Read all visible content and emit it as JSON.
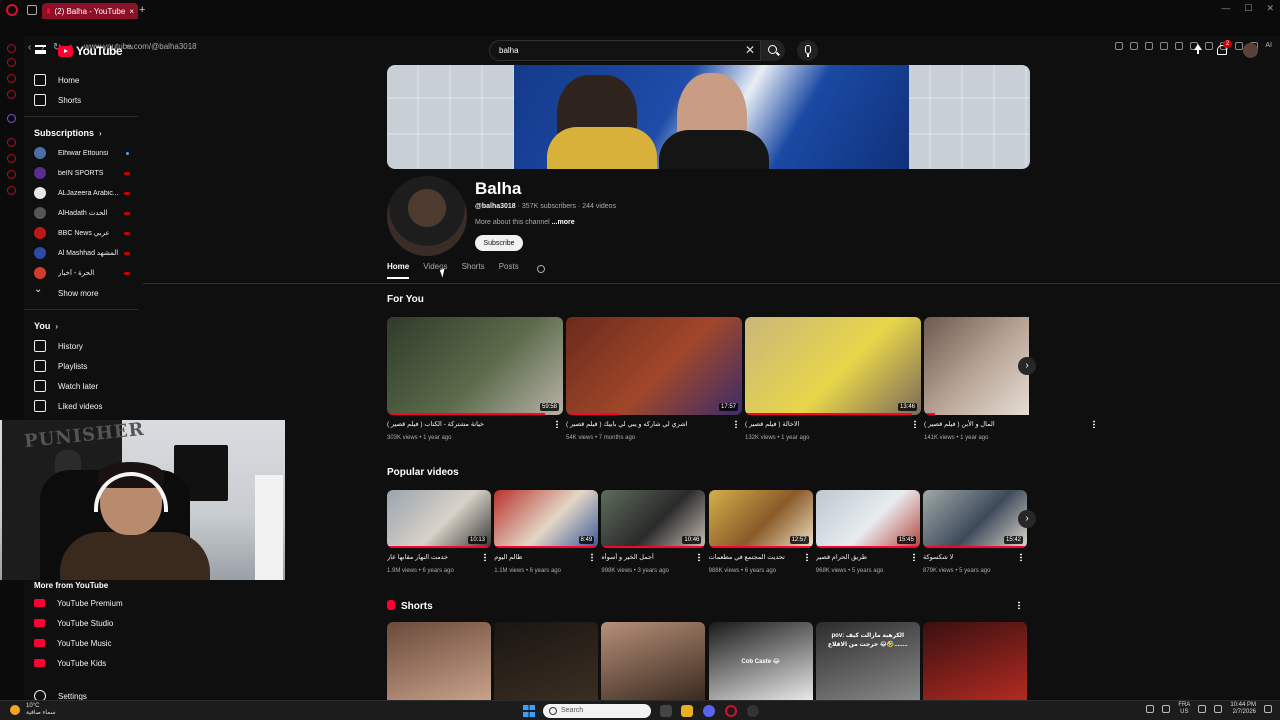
{
  "browser": {
    "tab_title": "(2) Balha - YouTube",
    "url": "www.youtube.com/@balha3018",
    "ai_label": "AI"
  },
  "header": {
    "logo_text": "YouTube",
    "logo_tm": "TN",
    "search_value": "balha",
    "notification_count": "2"
  },
  "sidebar": {
    "main": [
      {
        "label": "Home",
        "icon": "home-icon"
      },
      {
        "label": "Shorts",
        "icon": "shorts-icon"
      }
    ],
    "subscriptions_title": "Subscriptions",
    "subscriptions": [
      {
        "label": "Elhiwar Ettounsi",
        "color": "#4a6fa5",
        "indicator": "dot"
      },
      {
        "label": "beIN SPORTS",
        "color": "#5b2d8e",
        "indicator": "live"
      },
      {
        "label": "ALJazeera Arabic...",
        "color": "#e8e8e8",
        "indicator": "live"
      },
      {
        "label": "AlHadath الحدث",
        "color": "#555555",
        "indicator": "live"
      },
      {
        "label": "BBC News عربي",
        "color": "#bb1919",
        "indicator": "live"
      },
      {
        "label": "Al Mashhad المشهد",
        "color": "#2c4aa8",
        "indicator": "live"
      },
      {
        "label": "الحرة - أخبار",
        "color": "#d23a2a",
        "indicator": "live"
      }
    ],
    "show_more": "Show more",
    "you_title": "You",
    "you_items": [
      {
        "label": "History",
        "icon": "history-icon"
      },
      {
        "label": "Playlists",
        "icon": "playlists-icon"
      },
      {
        "label": "Watch later",
        "icon": "watch-later-icon"
      },
      {
        "label": "Liked videos",
        "icon": "like-icon"
      }
    ],
    "more_title": "More from YouTube",
    "more_items": [
      {
        "label": "YouTube Premium"
      },
      {
        "label": "YouTube Studio"
      },
      {
        "label": "YouTube Music"
      },
      {
        "label": "YouTube Kids"
      }
    ],
    "settings": "Settings"
  },
  "webcam": {
    "poster_text": "PUNISHER"
  },
  "channel": {
    "name": "Balha",
    "handle": "@balha3018",
    "stats": " · 357K subscribers · 244 videos",
    "about": "More about this channel",
    "about_more": "...more",
    "subscribe": "Subscribe",
    "tabs": [
      "Home",
      "Videos",
      "Shorts",
      "Posts"
    ]
  },
  "for_you": {
    "title": "For You",
    "videos": [
      {
        "title": "خيانة مشتركة - الكتاب ( فيلم قصير )",
        "meta": "303K views • 1 year ago",
        "duration": "59:58",
        "progress": 0.9,
        "colors": [
          "#2f3b2a",
          "#5b6b4a",
          "#b8b2a8"
        ]
      },
      {
        "title": "اشري لي شاركه و يبي لي بابيك ( فيلم قصير )",
        "meta": "54K views • 7 months ago",
        "duration": "17:57",
        "progress": 0.3,
        "colors": [
          "#6b2a1c",
          "#a0472a",
          "#3c2c6a"
        ]
      },
      {
        "title": "الاخالة ( فيلم قصير )",
        "meta": "132K views • 1 year ago",
        "duration": "13:46",
        "progress": 0.95,
        "colors": [
          "#c9b77a",
          "#e8d64a",
          "#7a6a5a"
        ]
      },
      {
        "title": "المال و الأبن ( فيلم قصير )",
        "meta": "141K views • 1 year ago",
        "duration": "",
        "progress": 0.1,
        "colors": [
          "#6e5a4e",
          "#bba89a",
          "#e6ddd4"
        ]
      }
    ]
  },
  "popular": {
    "title": "Popular videos",
    "videos": [
      {
        "title": "خدمت النهار مقابها عار",
        "meta": "1.9M views • 6 years ago",
        "duration": "10:13",
        "colors": [
          "#9aa4ad",
          "#d8d2c8",
          "#3a3a3a"
        ]
      },
      {
        "title": "ظالم اليوم",
        "meta": "1.1M views • 6 years ago",
        "duration": "8:49",
        "colors": [
          "#b8322c",
          "#e4d7c6",
          "#3a5a9a"
        ]
      },
      {
        "title": "أجمل الخير و أسوأه",
        "meta": "998K views • 3 years ago",
        "duration": "10:46",
        "colors": [
          "#5e6d5a",
          "#2a2a2a",
          "#c7bfb3"
        ]
      },
      {
        "title": "تحديت المجتمع في مطعمات",
        "meta": "988K views • 6 years ago",
        "duration": "12:57",
        "colors": [
          "#d3b04a",
          "#8a5a2a",
          "#f0e0c0"
        ]
      },
      {
        "title": "طريق الحرام قصير",
        "meta": "968K views • 5 years ago",
        "duration": "15:45",
        "colors": [
          "#bcc7cf",
          "#e8ecef",
          "#b5433a"
        ]
      },
      {
        "title": "لا شكسوكة",
        "meta": "879K views • 5 years ago",
        "duration": "15:42",
        "colors": [
          "#9fa9a8",
          "#3e4a5a",
          "#ddd8cc"
        ]
      }
    ]
  },
  "shorts": {
    "title": "Shorts",
    "items": [
      {
        "caption": "",
        "colors": [
          "#6a4a3a",
          "#c9a28a"
        ]
      },
      {
        "caption": "",
        "colors": [
          "#1a1612",
          "#3b2e22"
        ]
      },
      {
        "caption": "",
        "colors": [
          "#b69078",
          "#3a2a20"
        ]
      },
      {
        "caption": "Cob Caste 😂",
        "colors": [
          "#1a1a1a",
          "#e9e9e9"
        ]
      },
      {
        "caption": "pov: الكرهبة مازالت كيف خرجت من الاقلاع 😂🤣........",
        "colors": [
          "#2c2c2c",
          "#8a8a8a"
        ]
      },
      {
        "caption": "",
        "colors": [
          "#3a1010",
          "#b22a22"
        ]
      }
    ]
  },
  "taskbar": {
    "temp": "10°C",
    "weather_text": "سماء صافية",
    "search_placeholder": "Search",
    "lang": "FRA",
    "region": "US",
    "time": "10:44 PM",
    "date": "2/7/2026"
  }
}
